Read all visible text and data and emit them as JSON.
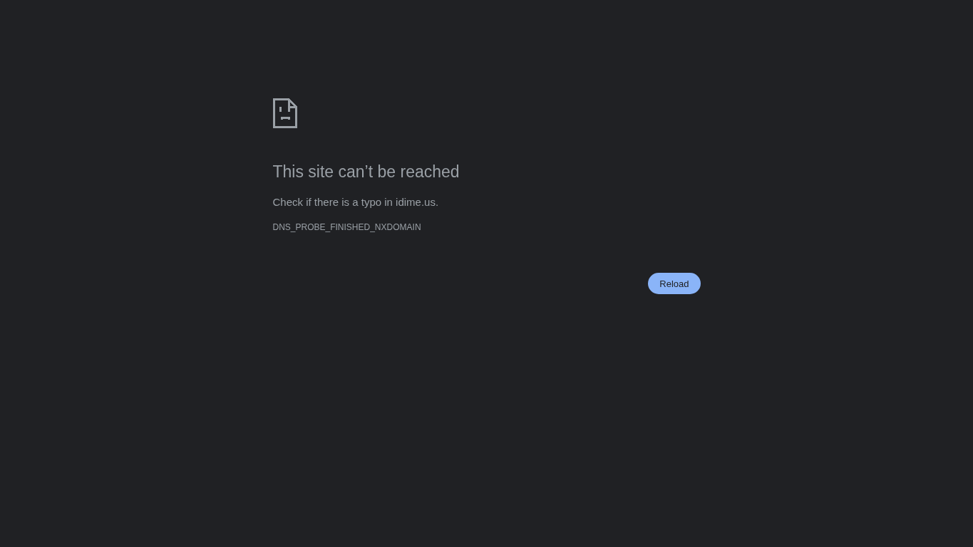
{
  "error_page": {
    "heading": "This site can’t be reached",
    "message": "Check if there is a typo in idime.us.",
    "error_code": "DNS_PROBE_FINISHED_NXDOMAIN",
    "buttons": [
      {
        "label": "Reload"
      }
    ]
  }
}
